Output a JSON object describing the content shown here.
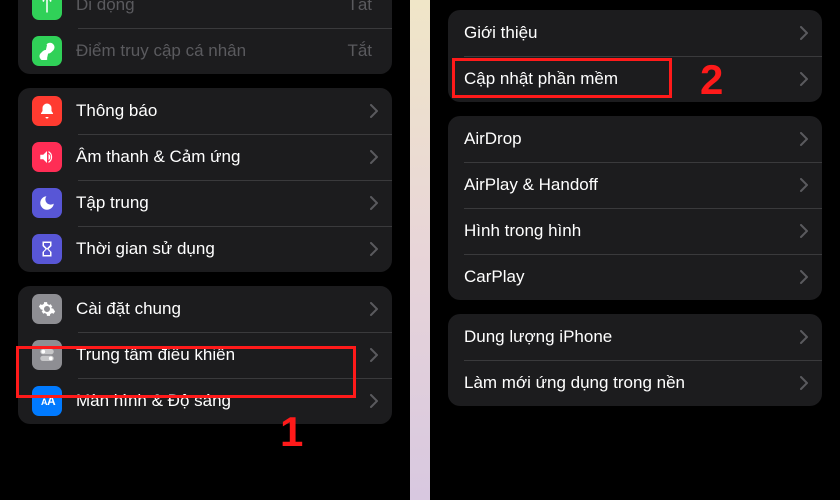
{
  "left": {
    "group1": {
      "mobile": {
        "label": "Di động",
        "value": "Tắt"
      },
      "hotspot": {
        "label": "Điểm truy cập cá nhân",
        "value": "Tắt"
      }
    },
    "group2": {
      "notifications": "Thông báo",
      "sounds": "Âm thanh & Cảm ứng",
      "focus": "Tập trung",
      "screentime": "Thời gian sử dụng"
    },
    "group3": {
      "general": "Cài đặt chung",
      "controlcenter": "Trung tâm điều khiển",
      "display": "Màn hình & Độ sáng"
    }
  },
  "right": {
    "group1": {
      "about": "Giới thiệu",
      "update": "Cập nhật phần mềm"
    },
    "group2": {
      "airdrop": "AirDrop",
      "airplay": "AirPlay & Handoff",
      "pip": "Hình trong hình",
      "carplay": "CarPlay"
    },
    "group3": {
      "storage": "Dung lượng iPhone",
      "refresh": "Làm mới ứng dụng trong nền"
    }
  },
  "annotations": {
    "one": "1",
    "two": "2"
  },
  "colors": {
    "red": "#ff3b30",
    "green": "#30d158",
    "indigo": "#5856d6",
    "blue": "#007aff",
    "gray": "#8e8e93",
    "darkgray": "#3a3a3c",
    "highlight": "#ff1a1a"
  }
}
